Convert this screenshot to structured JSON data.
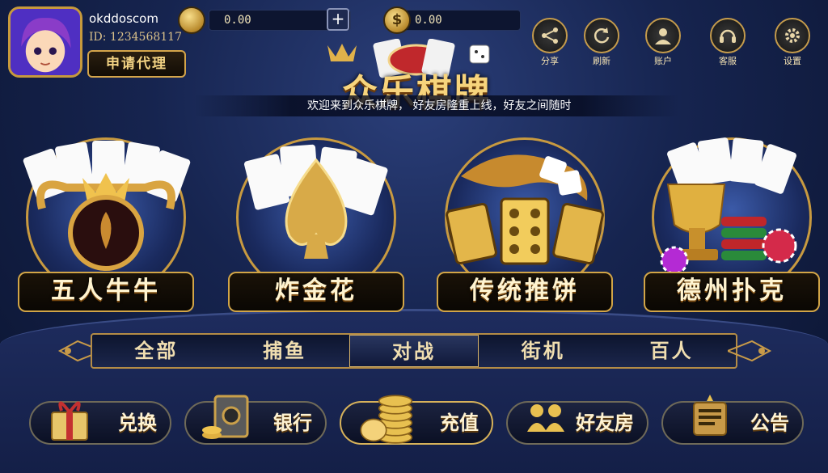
{
  "user": {
    "name": "okddoscom",
    "id": "ID: 1234568117",
    "agent_label": "申请代理"
  },
  "wallet": {
    "coin_value": "0.00",
    "cash_value": "0.00",
    "coin_symbol": "$",
    "add_symbol": "+"
  },
  "top_menu": [
    {
      "label": "分享",
      "icon": "share-icon"
    },
    {
      "label": "刷新",
      "icon": "refresh-icon"
    },
    {
      "label": "账户",
      "icon": "account-icon"
    },
    {
      "label": "客服",
      "icon": "headset-icon"
    },
    {
      "label": "设置",
      "icon": "gear-icon"
    }
  ],
  "logo": {
    "title": "众乐棋牌"
  },
  "marquee": {
    "text": "欢迎来到众乐棋牌，       好友房隆重上线，好友之间随时"
  },
  "games": [
    {
      "label": "五人牛牛",
      "icon": "bull-crown-icon"
    },
    {
      "label": "炸金花",
      "icon": "spade-icon"
    },
    {
      "label": "传统推饼",
      "icon": "dragon-tile-icon"
    },
    {
      "label": "德州扑克",
      "icon": "trophy-chips-icon"
    }
  ],
  "categories": [
    {
      "label": "全部",
      "active": false
    },
    {
      "label": "捕鱼",
      "active": false
    },
    {
      "label": "对战",
      "active": true
    },
    {
      "label": "街机",
      "active": false
    },
    {
      "label": "百人",
      "active": false
    }
  ],
  "bottom_menu": [
    {
      "label": "兑换",
      "icon": "gift-box-icon"
    },
    {
      "label": "银行",
      "icon": "safe-icon"
    },
    {
      "label": "充值",
      "icon": "coin-stack-icon"
    },
    {
      "label": "好友房",
      "icon": "friends-icon"
    },
    {
      "label": "公告",
      "icon": "notice-icon"
    }
  ],
  "colors": {
    "gold": "#d4a54a",
    "background": "#16244f",
    "text_light": "#f0deb0"
  }
}
